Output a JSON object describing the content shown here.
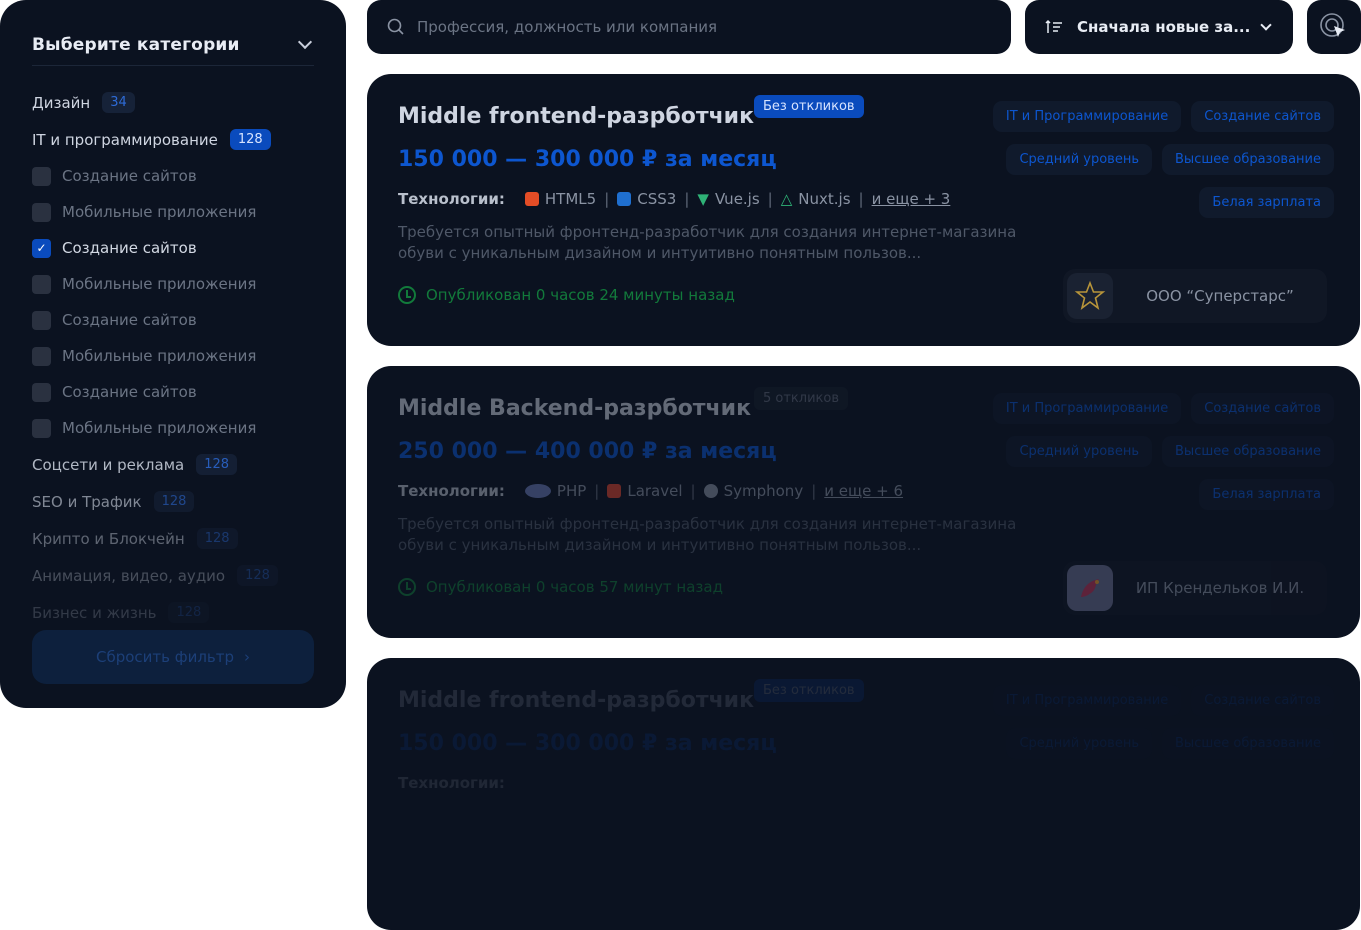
{
  "sidebar": {
    "title": "Выберите категории",
    "categories": [
      {
        "label": "Дизайн",
        "count": "34"
      },
      {
        "label": "IT и программирование",
        "count": "128"
      }
    ],
    "subcategories": [
      {
        "label": "Создание сайтов",
        "checked": false
      },
      {
        "label": "Мобильные приложения",
        "checked": false
      },
      {
        "label": "Создание сайтов",
        "checked": true
      },
      {
        "label": "Мобильные приложения",
        "checked": false
      },
      {
        "label": "Создание сайтов",
        "checked": false
      },
      {
        "label": "Мобильные приложения",
        "checked": false
      },
      {
        "label": "Создание сайтов",
        "checked": false
      },
      {
        "label": "Мобильные приложения",
        "checked": false
      }
    ],
    "more_categories": [
      {
        "label": "Соцсети и реклама",
        "count": "128"
      },
      {
        "label": "SEO и Трафик",
        "count": "128"
      },
      {
        "label": "Крипто и Блокчейн",
        "count": "128"
      },
      {
        "label": "Анимация, видео, аудио",
        "count": "128"
      },
      {
        "label": "Бизнес и жизнь",
        "count": "128"
      }
    ],
    "reset_label": "Сбросить фильтр"
  },
  "search": {
    "placeholder": "Профессия, должность или компания"
  },
  "sort": {
    "label": "Сначала новые за..."
  },
  "cards": [
    {
      "title": "Middle frontend-разрботчик",
      "badge": "Без откликов",
      "salary": "150 000 — 300 000 ₽ за месяц",
      "tech_label": "Технологии:",
      "tech": [
        "HTML5",
        "CSS3",
        "Vue.js",
        "Nuxt.js"
      ],
      "tech_more": "и еще + 3",
      "description": "Требуется опытный фронтенд-разработчик для создания интернет-магазина обуви с уникальным дизайном и интуитивно понятным пользов...",
      "published": "Опубликован 0 часов 24 минуты назад",
      "tags": [
        "IT и Программирование",
        "Создание сайтов",
        "Средний уровень",
        "Высшее образование",
        "Белая зарплата"
      ],
      "company": "ООО “Суперстарс”"
    },
    {
      "title": "Middle Backend-разрботчик",
      "badge": "5 откликов",
      "salary": "250 000 — 400 000 ₽ за месяц",
      "tech_label": "Технологии:",
      "tech": [
        "PHP",
        "Laravel",
        "Symphony"
      ],
      "tech_more": "и еще + 6",
      "description": "Требуется опытный фронтенд-разработчик для создания интернет-магазина обуви с уникальным дизайном и интуитивно понятным пользов...",
      "published": "Опубликован 0 часов 57 минут назад",
      "tags": [
        "IT и Программирование",
        "Создание сайтов",
        "Средний уровень",
        "Высшее образование",
        "Белая зарплата"
      ],
      "company": "ИП Крендельков И.И."
    },
    {
      "title": "Middle frontend-разрботчик",
      "badge": "Без откликов",
      "salary": "150 000 — 300 000 ₽ за месяц",
      "tech_label": "Технологии:",
      "tags": [
        "IT и Программирование",
        "Создание сайтов",
        "Средний уровень",
        "Высшее образование"
      ]
    }
  ]
}
